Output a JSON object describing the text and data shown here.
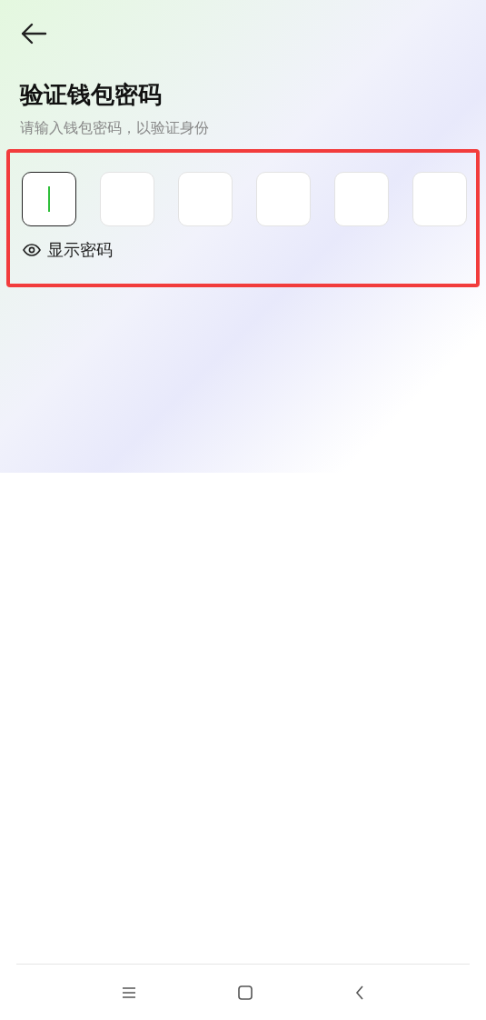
{
  "title": "验证钱包密码",
  "subtitle": "请输入钱包密码，以验证身份",
  "pin_boxes": [
    {
      "focused": true
    },
    {
      "focused": false
    },
    {
      "focused": false
    },
    {
      "focused": false
    },
    {
      "focused": false
    },
    {
      "focused": false
    }
  ],
  "show_password": {
    "label": "显示密码"
  }
}
